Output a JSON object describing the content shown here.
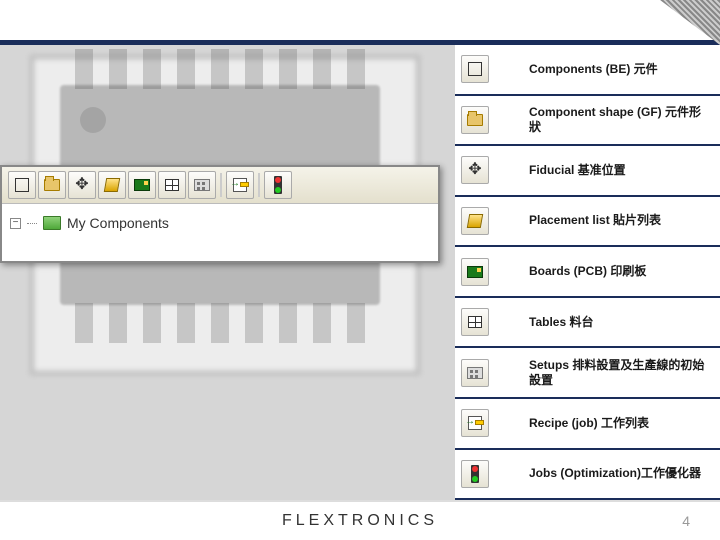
{
  "footer": {
    "brand": "FLEXTRONICS",
    "page_number": "4"
  },
  "tree": {
    "root_label": "My Components"
  },
  "items": [
    {
      "key": "components",
      "icon": "chip-icon",
      "label": "Components (BE) 元件"
    },
    {
      "key": "component_shape",
      "icon": "folder-icon",
      "label": "Component shape (GF) 元件形狀"
    },
    {
      "key": "fiducial",
      "icon": "fiducial-icon",
      "label": "Fiducial  基准位置"
    },
    {
      "key": "placement_list",
      "icon": "placement-icon",
      "label": "Placement list 貼片列表"
    },
    {
      "key": "boards",
      "icon": "board-icon",
      "label": "Boards (PCB) 印刷板"
    },
    {
      "key": "tables",
      "icon": "table-icon",
      "label": "Tables  料台"
    },
    {
      "key": "setups",
      "icon": "setup-icon",
      "label": "Setups 排料設置及生產線的初始設置"
    },
    {
      "key": "recipe",
      "icon": "recipe-icon",
      "label": "Recipe (job) 工作列表"
    },
    {
      "key": "jobs",
      "icon": "traffic-light-icon",
      "label": "Jobs (Optimization)工作優化器"
    }
  ],
  "toolbar_icons": [
    "chip",
    "folder",
    "fiducial",
    "placement",
    "board",
    "table",
    "setup",
    "recipe",
    "light"
  ]
}
